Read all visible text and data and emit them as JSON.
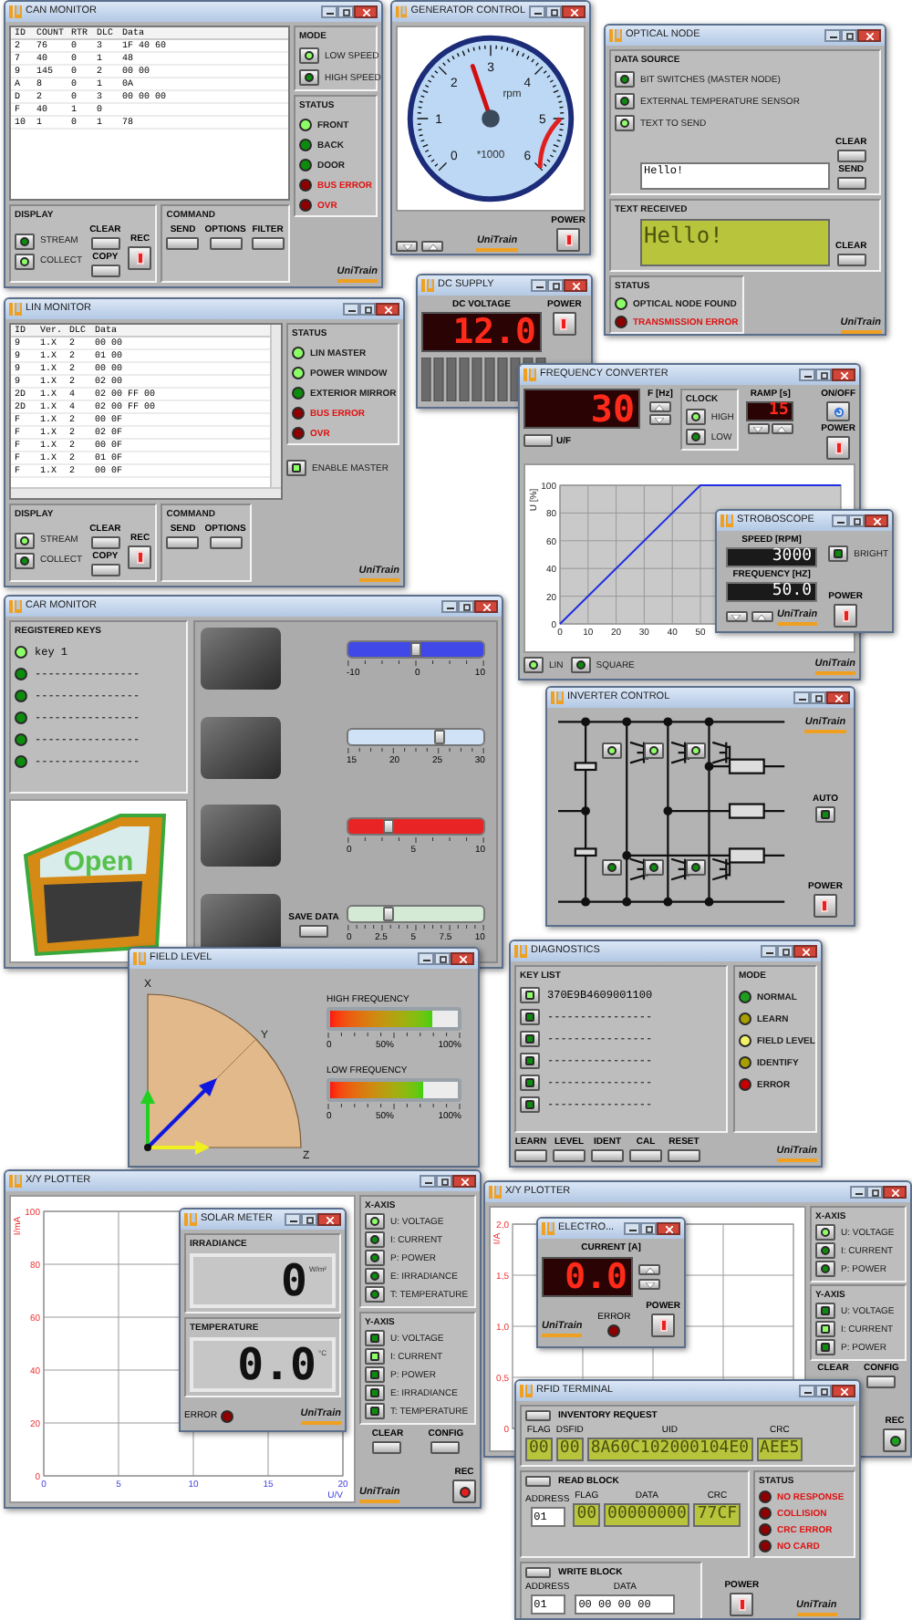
{
  "windows": [
    {
      "kind": "can",
      "title": "CAN MONITOR",
      "table": {
        "columns": [
          "ID",
          "COUNT",
          "RTR",
          "DLC",
          "Data"
        ],
        "rows": [
          [
            "2",
            "76",
            "0",
            "3",
            "1F 40 60"
          ],
          [
            "7",
            "40",
            "0",
            "1",
            "48"
          ],
          [
            "9",
            "145",
            "0",
            "2",
            "00 00"
          ],
          [
            "A",
            "8",
            "0",
            "1",
            "0A"
          ],
          [
            "D",
            "2",
            "0",
            "3",
            "00 00 00"
          ],
          [
            "F",
            "40",
            "1",
            "0"
          ],
          [
            "10",
            "1",
            "0",
            "1",
            "78"
          ]
        ]
      },
      "mode": {
        "title": "MODE",
        "options": [
          {
            "label": "LOW SPEED",
            "on": true
          },
          {
            "label": "HIGH SPEED",
            "on": false
          }
        ]
      },
      "status": {
        "title": "STATUS",
        "leds": [
          {
            "label": "FRONT",
            "on": true,
            "error": false
          },
          {
            "label": "BACK",
            "on": false,
            "error": false
          },
          {
            "label": "DOOR",
            "on": false,
            "error": false
          },
          {
            "label": "BUS ERROR",
            "on": false,
            "error": true
          },
          {
            "label": "OVR",
            "on": false,
            "error": true
          }
        ]
      },
      "display": {
        "title": "DISPLAY",
        "toggles": [
          {
            "label": "STREAM",
            "on": false
          },
          {
            "label": "COLLECT",
            "on": true
          }
        ],
        "buttons": [
          "CLEAR",
          "COPY"
        ],
        "rec": "REC"
      },
      "command": {
        "title": "COMMAND",
        "buttons": [
          "SEND",
          "OPTIONS",
          "FILTER"
        ]
      },
      "logo": "UniTrain"
    },
    {
      "kind": "generator",
      "title": "GENERATOR CONTROL",
      "gauge": {
        "ticks": [
          "0",
          "1",
          "2",
          "3",
          "4",
          "5",
          "6"
        ],
        "unit": "rpm",
        "multiplier": "*1000",
        "level": 0.43
      },
      "power": "POWER",
      "logo": "UniTrain"
    },
    {
      "kind": "optical",
      "title": "OPTICAL NODE",
      "source": {
        "title": "DATA SOURCE",
        "options": [
          {
            "label": "BIT SWITCHES (MASTER NODE)",
            "on": false
          },
          {
            "label": "EXTERNAL TEMPERATURE SENSOR",
            "on": false
          },
          {
            "label": "TEXT TO SEND",
            "on": true
          }
        ],
        "text": "Hello!",
        "clear": "CLEAR",
        "send": "SEND"
      },
      "received": {
        "title": "TEXT RECEIVED",
        "text": "Hello!",
        "clear": "CLEAR"
      },
      "status": {
        "title": "STATUS",
        "leds": [
          {
            "label": "OPTICAL NODE FOUND",
            "on": true,
            "error": false
          },
          {
            "label": "TRANSMISSION ERROR",
            "on": false,
            "error": true
          }
        ]
      },
      "logo": "UniTrain"
    },
    {
      "kind": "dc",
      "title": "DC SUPPLY",
      "label": "DC VOLTAGE",
      "value": "12.0",
      "power": "POWER"
    },
    {
      "kind": "lin",
      "title": "LIN MONITOR",
      "table": {
        "columns": [
          "ID",
          "Ver.",
          "DLC",
          "Data"
        ],
        "rows": [
          [
            "9",
            "1.X",
            "2",
            "00 00"
          ],
          [
            "9",
            "1.X",
            "2",
            "01 00"
          ],
          [
            "9",
            "1.X",
            "2",
            "00 00"
          ],
          [
            "9",
            "1.X",
            "2",
            "02 00"
          ],
          [
            "2D",
            "1.X",
            "4",
            "02 00 FF 00"
          ],
          [
            "2D",
            "1.X",
            "4",
            "02 00 FF 00"
          ],
          [
            "F",
            "1.X",
            "2",
            "00 0F"
          ],
          [
            "F",
            "1.X",
            "2",
            "02 0F"
          ],
          [
            "F",
            "1.X",
            "2",
            "00 0F"
          ],
          [
            "F",
            "1.X",
            "2",
            "01 0F"
          ],
          [
            "F",
            "1.X",
            "2",
            "00 0F"
          ]
        ]
      },
      "status": {
        "title": "STATUS",
        "leds": [
          {
            "label": "LIN MASTER",
            "on": true,
            "error": false
          },
          {
            "label": "POWER WINDOW",
            "on": true,
            "error": false
          },
          {
            "label": "EXTERIOR MIRROR",
            "on": false,
            "error": false
          },
          {
            "label": "BUS ERROR",
            "on": false,
            "error": true
          },
          {
            "label": "OVR",
            "on": false,
            "error": true
          }
        ]
      },
      "enable": {
        "label": "ENABLE MASTER",
        "on": true
      },
      "display": {
        "title": "DISPLAY",
        "toggles": [
          {
            "label": "STREAM",
            "on": true
          },
          {
            "label": "COLLECT",
            "on": false
          }
        ],
        "buttons": [
          "CLEAR",
          "COPY"
        ],
        "rec": "REC"
      },
      "command": {
        "title": "COMMAND",
        "buttons": [
          "SEND",
          "OPTIONS"
        ]
      },
      "logo": "UniTrain"
    },
    {
      "kind": "freq",
      "title": "FREQUENCY CONVERTER",
      "value": "30",
      "f_label": "F [Hz]",
      "clock": {
        "title": "CLOCK",
        "options": [
          {
            "label": "HIGH",
            "on": true
          },
          {
            "label": "LOW",
            "on": false
          }
        ]
      },
      "ramp": {
        "label": "RAMP [s]",
        "value": "15"
      },
      "onoff": "ON/OFF",
      "power": "POWER",
      "uf": "U/F",
      "chart_data": {
        "type": "line",
        "grid": true,
        "ylabel": "U [%]",
        "x": [
          0,
          50,
          100
        ],
        "series": [
          {
            "color": "#1f2ee0",
            "values": [
              0,
              100,
              100
            ]
          }
        ],
        "xlim": [
          0,
          100
        ],
        "ylim": [
          0,
          100
        ],
        "xticks": [
          0,
          10,
          20,
          30,
          40,
          50
        ],
        "yticks": [
          0,
          20,
          40,
          60,
          80,
          100
        ]
      },
      "waveforms": [
        {
          "label": "LIN",
          "on": true
        },
        {
          "label": "SQUARE",
          "on": false
        }
      ],
      "logo": "UniTrain"
    },
    {
      "kind": "strobe",
      "title": "STROBOSCOPE",
      "speed": {
        "label": "SPEED [RPM]",
        "value": "3000"
      },
      "bright": {
        "label": "BRIGHT",
        "on": false
      },
      "frequency": {
        "label": "FREQUENCY [HZ]",
        "value": "50.0"
      },
      "power": "POWER",
      "logo": "UniTrain"
    },
    {
      "kind": "car",
      "title": "CAR MONITOR",
      "keys": {
        "title": "REGISTERED KEYS",
        "items": [
          {
            "label": "key 1",
            "on": true
          },
          {
            "label": "----------------",
            "on": false
          },
          {
            "label": "----------------",
            "on": false
          },
          {
            "label": "----------------",
            "on": false
          },
          {
            "label": "----------------",
            "on": false
          },
          {
            "label": "----------------",
            "on": false
          }
        ]
      },
      "door": "Open",
      "sliders": [
        {
          "ticks": [
            "-10",
            "0",
            "10"
          ],
          "level": 0.5,
          "color": "#4048e8"
        },
        {
          "ticks": [
            "15",
            "20",
            "25",
            "30"
          ],
          "level": 0.67,
          "color": "#cfe2f6"
        },
        {
          "ticks": [
            "0",
            "5",
            "10"
          ],
          "level": 0.3,
          "color": "#e82424"
        },
        {
          "ticks": [
            "0",
            "2.5",
            "5",
            "7.5",
            "10"
          ],
          "level": 0.3,
          "color": "#d4ead4"
        }
      ],
      "save": "SAVE DATA"
    },
    {
      "kind": "inverter",
      "title": "INVERTER CONTROL",
      "switches": [
        {
          "on": true
        },
        {
          "on": true
        },
        {
          "on": true
        },
        {
          "on": false
        },
        {
          "on": false
        },
        {
          "on": false
        }
      ],
      "auto": {
        "label": "AUTO",
        "on": false
      },
      "power": "POWER",
      "logo": "UniTrain"
    },
    {
      "kind": "field",
      "title": "FIELD LEVEL",
      "axes": [
        "X",
        "Y",
        "Z"
      ],
      "bars": [
        {
          "label": "HIGH FREQUENCY",
          "level": 0.8,
          "ticks": [
            "0",
            "50%",
            "100%"
          ]
        },
        {
          "label": "LOW FREQUENCY",
          "level": 0.73,
          "ticks": [
            "0",
            "50%",
            "100%"
          ]
        }
      ]
    },
    {
      "kind": "diag",
      "title": "DIAGNOSTICS",
      "keys": {
        "title": "KEY LIST",
        "items": [
          {
            "label": "370E9B4609001100",
            "on": true
          },
          {
            "label": "----------------",
            "on": false
          },
          {
            "label": "----------------",
            "on": false
          },
          {
            "label": "----------------",
            "on": false
          },
          {
            "label": "----------------",
            "on": false
          },
          {
            "label": "----------------",
            "on": false
          }
        ]
      },
      "mode": {
        "title": "MODE",
        "leds": [
          {
            "label": "NORMAL",
            "color": "#1e9e1e"
          },
          {
            "label": "LEARN",
            "color": "#a89e00"
          },
          {
            "label": "FIELD LEVEL",
            "color": "#f2f266"
          },
          {
            "label": "IDENTIFY",
            "color": "#a89e00"
          },
          {
            "label": "ERROR",
            "color": "#c40000"
          }
        ]
      },
      "buttons": [
        "LEARN",
        "LEVEL",
        "IDENT",
        "CAL",
        "RESET"
      ],
      "logo": "UniTrain"
    },
    {
      "kind": "xy",
      "title": "X/Y PLOTTER",
      "chart_data": {
        "type": "line",
        "grid": true,
        "xlabel": "U/V",
        "ylabel": "I/mA",
        "xlim": [
          0,
          20
        ],
        "ylim": [
          0,
          100
        ],
        "xticks": [
          0,
          5,
          10,
          15,
          20
        ],
        "yticks": [
          0,
          20,
          40,
          60,
          80,
          100
        ]
      },
      "xaxis": {
        "title": "X-AXIS",
        "options": [
          {
            "label": "U: VOLTAGE",
            "on": true
          },
          {
            "label": "I: CURRENT",
            "on": false
          },
          {
            "label": "P: POWER",
            "on": false
          },
          {
            "label": "E: IRRADIANCE",
            "on": false
          },
          {
            "label": "T: TEMPERATURE",
            "on": false
          }
        ]
      },
      "yaxis": {
        "title": "Y-AXIS",
        "options": [
          {
            "label": "U: VOLTAGE",
            "on": false
          },
          {
            "label": "I: CURRENT",
            "on": true
          },
          {
            "label": "P: POWER",
            "on": false
          },
          {
            "label": "E: IRRADIANCE",
            "on": false
          },
          {
            "label": "T: TEMPERATURE",
            "on": false
          }
        ]
      },
      "clear": "CLEAR",
      "config": "CONFIG",
      "rec": {
        "label": "REC",
        "color": "#e02020"
      },
      "logo": "UniTrain"
    },
    {
      "kind": "solar",
      "title": "SOLAR METER",
      "readings": [
        {
          "label": "IRRADIANCE",
          "value": "0",
          "unit": "W/m²"
        },
        {
          "label": "TEMPERATURE",
          "value": "0.0",
          "unit": "°C"
        }
      ],
      "error": {
        "label": "ERROR",
        "on": false
      },
      "logo": "UniTrain"
    },
    {
      "kind": "xy",
      "title": "X/Y PLOTTER",
      "chart_data": {
        "type": "line",
        "grid": true,
        "categories": [
          null,
          null,
          null,
          null
        ],
        "ylabel": "I/A",
        "ylim": [
          0,
          2
        ],
        "yticks": [
          {
            "value": 0,
            "label": "0"
          },
          {
            "value": 0.5,
            "label": "0,5"
          },
          {
            "value": 1,
            "label": "1,0"
          },
          {
            "value": 1.5,
            "label": "1,5"
          },
          {
            "value": 2,
            "label": "2,0"
          }
        ]
      },
      "xaxis": {
        "title": "X-AXIS",
        "options": [
          {
            "label": "U: VOLTAGE",
            "on": true
          },
          {
            "label": "I: CURRENT",
            "on": false
          },
          {
            "label": "P: POWER",
            "on": false
          }
        ]
      },
      "yaxis": {
        "title": "Y-AXIS",
        "options": [
          {
            "label": "U: VOLTAGE",
            "on": false
          },
          {
            "label": "I: CURRENT",
            "on": true
          },
          {
            "label": "P: POWER",
            "on": false
          }
        ]
      },
      "clear": "CLEAR",
      "config": "CONFIG",
      "rec": {
        "label": "REC",
        "color": "#1ea01e"
      }
    },
    {
      "kind": "electro",
      "title": "ELECTRO...",
      "label": "CURRENT [A]",
      "value": "0.0",
      "error": {
        "label": "ERROR",
        "on": false
      },
      "power": "POWER",
      "logo": "UniTrain"
    },
    {
      "kind": "rfid",
      "title": "RFID TERMINAL",
      "inventory": {
        "button": "INVENTORY REQUEST",
        "fields": [
          {
            "label": "FLAG",
            "value": "00"
          },
          {
            "label": "DSFID",
            "value": "00"
          },
          {
            "label": "UID",
            "value": "8A60C102000104E0"
          },
          {
            "label": "CRC",
            "value": "AEE5"
          }
        ]
      },
      "read": {
        "button": "READ BLOCK",
        "address": {
          "label": "ADDRESS",
          "value": "01"
        },
        "fields": [
          {
            "label": "FLAG",
            "value": "00"
          },
          {
            "label": "DATA",
            "value": "00000000"
          },
          {
            "label": "CRC",
            "value": "77CF"
          }
        ]
      },
      "status": {
        "title": "STATUS",
        "leds": [
          {
            "label": "NO RESPONSE",
            "on": false,
            "error": true
          },
          {
            "label": "COLLISION",
            "on": false,
            "error": true
          },
          {
            "label": "CRC ERROR",
            "on": false,
            "error": true
          },
          {
            "label": "NO CARD",
            "on": false,
            "error": true
          }
        ]
      },
      "write": {
        "button": "WRITE BLOCK",
        "address": {
          "label": "ADDRESS",
          "value": "01"
        },
        "data": {
          "label": "DATA",
          "value": "00 00 00 00"
        }
      },
      "power": "POWER",
      "logo": "UniTrain"
    }
  ]
}
